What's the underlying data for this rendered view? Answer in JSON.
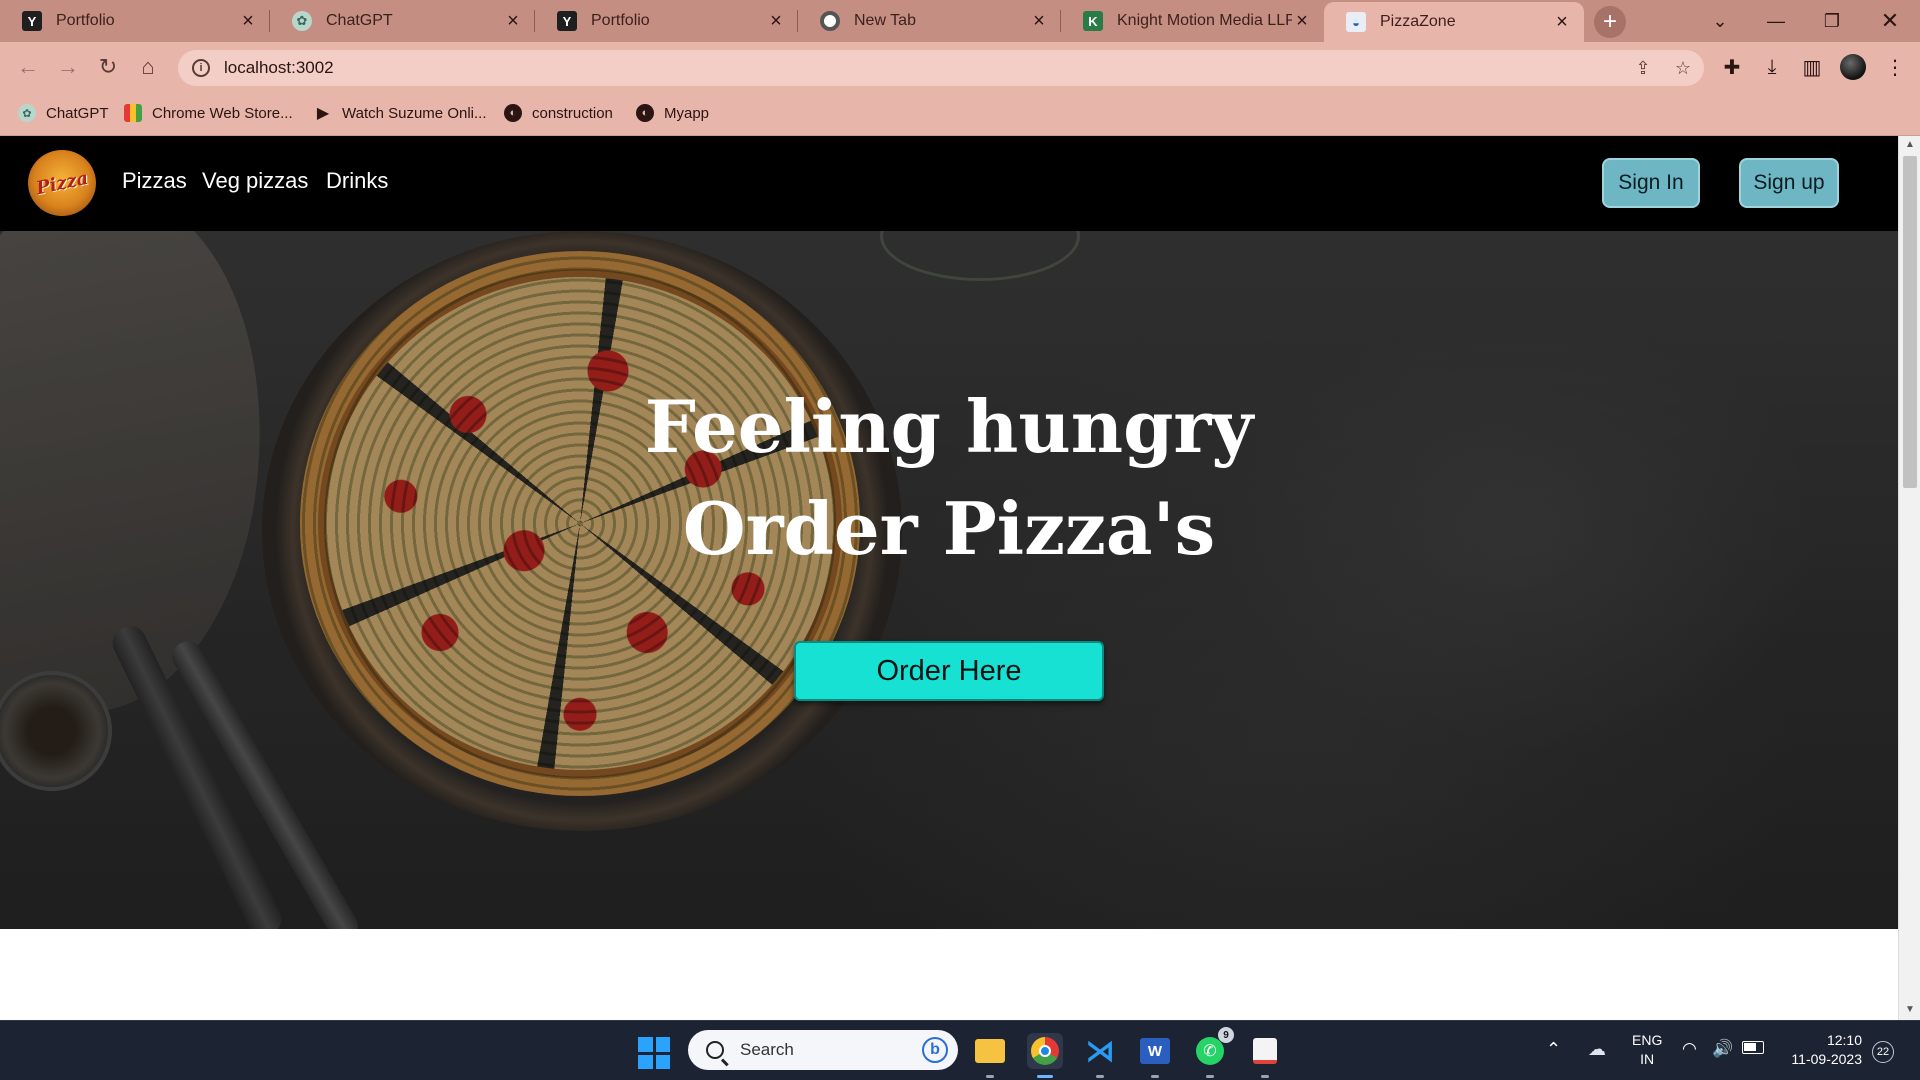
{
  "browser": {
    "tabs": [
      {
        "title": "Portfolio",
        "icon": "y-favicon-icon",
        "letter": "Y"
      },
      {
        "title": "ChatGPT",
        "icon": "chatgpt-favicon-icon",
        "letter": "✿"
      },
      {
        "title": "Portfolio",
        "icon": "y-favicon-icon",
        "letter": "Y"
      },
      {
        "title": "New Tab",
        "icon": "chrome-favicon-icon",
        "letter": ""
      },
      {
        "title": "Knight Motion Media LLP R",
        "icon": "knight-favicon-icon",
        "letter": "K"
      },
      {
        "title": "PizzaZone",
        "icon": "pizzazone-favicon-icon",
        "letter": "◒",
        "active": true
      }
    ],
    "url": "localhost:3002",
    "bookmarks": [
      {
        "label": "ChatGPT",
        "icon": "chatgpt-icon"
      },
      {
        "label": "Chrome Web Store...",
        "icon": "webstore-icon"
      },
      {
        "label": "Watch Suzume Onli...",
        "icon": "play-icon"
      },
      {
        "label": "construction",
        "icon": "globe-icon"
      },
      {
        "label": "Myapp",
        "icon": "globe-icon"
      }
    ]
  },
  "site": {
    "logo_text": "Pizza",
    "nav": [
      "Pizzas",
      "Veg pizzas",
      "Drinks"
    ],
    "sign_in": "Sign In",
    "sign_up": "Sign up",
    "hero": {
      "line1": "Feeling hungry",
      "line2": "Order Pizza's",
      "cta": "Order Here"
    }
  },
  "taskbar": {
    "search_placeholder": "Search",
    "whatsapp_badge": "9",
    "language": "ENG",
    "region": "IN",
    "time": "12:10",
    "date": "11-09-2023",
    "notifications": "22"
  }
}
